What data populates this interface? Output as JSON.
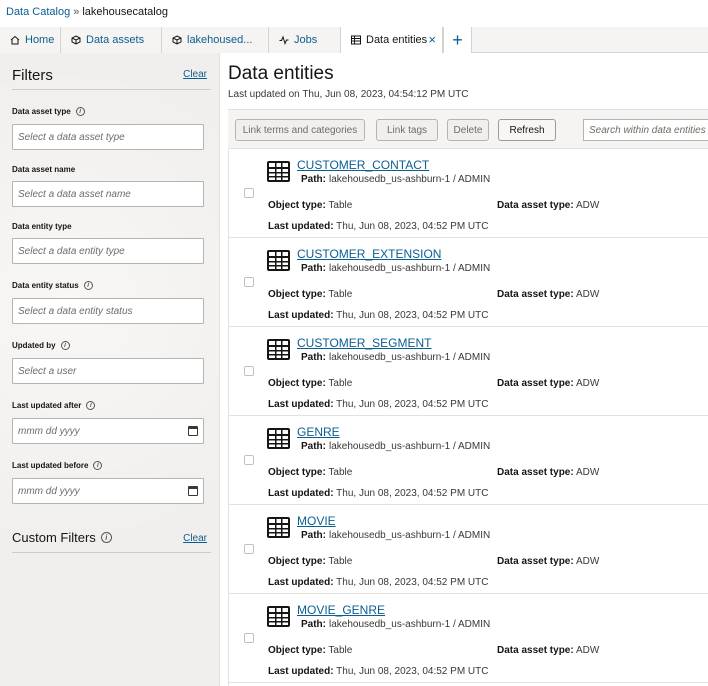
{
  "breadcrumb": {
    "root": "Data Catalog",
    "separator": "»",
    "current": "lakehousecatalog"
  },
  "tabs": [
    {
      "label": "Home",
      "icon": "home-icon"
    },
    {
      "label": "Data assets",
      "icon": "cube-icon"
    },
    {
      "label": "lakehoused...",
      "icon": "cube-icon"
    },
    {
      "label": "Jobs",
      "icon": "activity-icon"
    },
    {
      "label": "Data entities",
      "icon": "table-icon",
      "active": true,
      "close": "×"
    }
  ],
  "add_tab": "+",
  "filters": {
    "title": "Filters",
    "clear": "Clear",
    "fields": [
      {
        "label": "Data asset type",
        "info": true,
        "placeholder": "Select a data asset type"
      },
      {
        "label": "Data asset name",
        "info": false,
        "placeholder": "Select a data asset name"
      },
      {
        "label": "Data entity type",
        "info": false,
        "placeholder": "Select a data entity type"
      },
      {
        "label": "Data entity status",
        "info": true,
        "placeholder": "Select a data entity status"
      },
      {
        "label": "Updated by",
        "info": true,
        "placeholder": "Select a user"
      },
      {
        "label": "Last updated after",
        "info": true,
        "placeholder": "mmm dd yyyy"
      },
      {
        "label": "Last updated before",
        "info": true,
        "placeholder": "mmm dd yyyy"
      }
    ],
    "custom_title": "Custom Filters",
    "custom_clear": "Clear"
  },
  "main": {
    "title": "Data entities",
    "last_updated": "Last updated on Thu, Jun 08, 2023, 04:54:12 PM UTC",
    "toolbar": {
      "link_terms": "Link terms and categories",
      "link_tags": "Link tags",
      "delete": "Delete",
      "refresh": "Refresh",
      "search_placeholder": "Search within data entities"
    }
  },
  "labels": {
    "path": "Path:",
    "object_type": "Object type:",
    "data_asset_type": "Data asset type:",
    "last_updated": "Last updated:"
  },
  "entities": [
    {
      "name": "CUSTOMER_CONTACT",
      "path": "lakehousedb_us-ashburn-1 / ADMIN",
      "object_type": "Table",
      "data_asset_type": "ADW",
      "last_updated": "Thu, Jun 08, 2023, 04:52 PM UTC"
    },
    {
      "name": "CUSTOMER_EXTENSION",
      "path": "lakehousedb_us-ashburn-1 / ADMIN",
      "object_type": "Table",
      "data_asset_type": "ADW",
      "last_updated": "Thu, Jun 08, 2023, 04:52 PM UTC"
    },
    {
      "name": "CUSTOMER_SEGMENT",
      "path": "lakehousedb_us-ashburn-1 / ADMIN",
      "object_type": "Table",
      "data_asset_type": "ADW",
      "last_updated": "Thu, Jun 08, 2023, 04:52 PM UTC"
    },
    {
      "name": "GENRE",
      "path": "lakehousedb_us-ashburn-1 / ADMIN",
      "object_type": "Table",
      "data_asset_type": "ADW",
      "last_updated": "Thu, Jun 08, 2023, 04:52 PM UTC"
    },
    {
      "name": "MOVIE",
      "path": "lakehousedb_us-ashburn-1 / ADMIN",
      "object_type": "Table",
      "data_asset_type": "ADW",
      "last_updated": "Thu, Jun 08, 2023, 04:52 PM UTC"
    },
    {
      "name": "MOVIE_GENRE",
      "path": "lakehousedb_us-ashburn-1 / ADMIN",
      "object_type": "Table",
      "data_asset_type": "ADW",
      "last_updated": "Thu, Jun 08, 2023, 04:52 PM UTC"
    }
  ]
}
